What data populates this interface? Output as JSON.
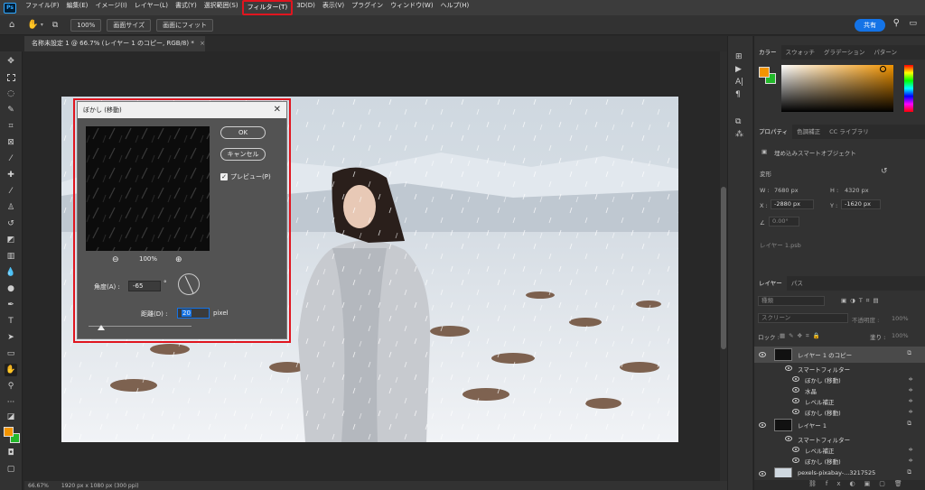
{
  "menubar": {
    "logo": "Ps",
    "items": [
      "ファイル(F)",
      "編集(E)",
      "イメージ(I)",
      "レイヤー(L)",
      "書式(Y)",
      "選択範囲(S)",
      "フィルター(T)",
      "3D(D)",
      "表示(V)",
      "プラグイン",
      "ウィンドウ(W)",
      "ヘルプ(H)"
    ],
    "active_index": 6
  },
  "optionsbar": {
    "zoom": "100%",
    "fit_screen": "画面サイズ",
    "fill_screen": "画面にフィット",
    "share": "共有"
  },
  "document": {
    "tab_title": "名称未設定 1 @ 66.7% (レイヤー 1 のコピー, RGB/8) *"
  },
  "status": {
    "zoom": "66.67%",
    "doc_info": "1920 px x 1080 px (300 ppi)"
  },
  "dialog": {
    "title": "ぼかし (移動)",
    "ok": "OK",
    "cancel": "キャンセル",
    "preview_label": "プレビュー(P)",
    "zoom": "100%",
    "angle_label": "角度(A) :",
    "angle_value": "-65",
    "angle_unit": "°",
    "distance_label": "距離(D) :",
    "distance_value": "20",
    "distance_unit": "pixel",
    "slider_fraction": 0.12
  },
  "color_panel": {
    "tabs": [
      "カラー",
      "スウォッチ",
      "グラデーション",
      "パターン"
    ],
    "foreground": "#f29400",
    "background": "#22b82a"
  },
  "properties_panel": {
    "tabs": [
      "プロパティ",
      "色調補正",
      "CC ライブラリ"
    ],
    "object_type": "埋め込みスマートオブジェクト",
    "transform_label": "変形",
    "w_label": "W :",
    "w_value": "7680 px",
    "h_label": "H :",
    "h_value": "4320 px",
    "x_label": "X :",
    "x_value": "-2880 px",
    "y_label": "Y :",
    "y_value": "-1620 px",
    "angle_value": "0.00°",
    "linked_file": "レイヤー 1.psb"
  },
  "layers_panel": {
    "tabs": [
      "レイヤー",
      "パス"
    ],
    "search": "種類",
    "blend_mode": "スクリーン",
    "opacity_label": "不透明度 :",
    "opacity_value": "100%",
    "lock_label": "ロック :",
    "fill_label": "塗り :",
    "fill_value": "100%",
    "layers": [
      {
        "name": "レイヤー 1 のコピー",
        "kind": "layer",
        "selected": true
      },
      {
        "name": "スマートフィルター",
        "kind": "group"
      },
      {
        "name": "ぼかし (移動)",
        "kind": "filter"
      },
      {
        "name": "水晶",
        "kind": "filter"
      },
      {
        "name": "レベル補正",
        "kind": "filter"
      },
      {
        "name": "ぼかし (移動)",
        "kind": "filter"
      },
      {
        "name": "レイヤー 1",
        "kind": "layer",
        "selected": false
      },
      {
        "name": "スマートフィルター",
        "kind": "group"
      },
      {
        "name": "レベル補正",
        "kind": "filter"
      },
      {
        "name": "ぼかし (移動)",
        "kind": "filter"
      },
      {
        "name": "pexels-pixabay-...3217525",
        "kind": "layer",
        "selected": false
      }
    ]
  }
}
